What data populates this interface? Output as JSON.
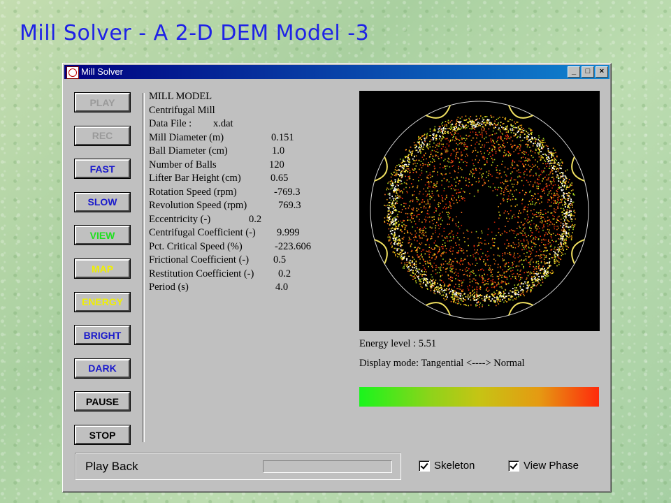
{
  "slide": {
    "title": "Mill Solver - A 2-D DEM Model -3"
  },
  "window": {
    "title": "Mill Solver",
    "controls": {
      "minimize": "_",
      "maximize": "□",
      "close": "×"
    }
  },
  "buttons": [
    {
      "label": "PLAY",
      "color": "#9a9a9a"
    },
    {
      "label": "REC",
      "color": "#9a9a9a"
    },
    {
      "label": "FAST",
      "color": "#1a1acc"
    },
    {
      "label": "SLOW",
      "color": "#1a1acc"
    },
    {
      "label": "VIEW",
      "color": "#20e020"
    },
    {
      "label": "MAP",
      "color": "#f0f000"
    },
    {
      "label": "ENERGY",
      "color": "#f0f000"
    },
    {
      "label": "BRIGHT",
      "color": "#1a1acc"
    },
    {
      "label": "DARK",
      "color": "#1a1acc"
    },
    {
      "label": "PAUSE",
      "color": "#000000"
    },
    {
      "label": "STOP",
      "color": "#000000"
    }
  ],
  "model": {
    "heading": "MILL MODEL",
    "type": "Centrifugal Mill",
    "params": [
      {
        "label": "Data File :",
        "value": "x.dat"
      },
      {
        "label": "Mill Diameter (m)",
        "value": "0.151"
      },
      {
        "label": "Ball Diameter (cm)",
        "value": "1.0"
      },
      {
        "label": "Number of Balls",
        "value": "120"
      },
      {
        "label": "Lifter Bar Height (cm)",
        "value": "0.65"
      },
      {
        "label": "Rotation Speed (rpm)",
        "value": "-769.3"
      },
      {
        "label": "Revolution Speed (rpm)",
        "value": "769.3"
      },
      {
        "label": "Eccentricity (-)",
        "value": "0.2"
      },
      {
        "label": "Centrifugal Coefficient (-)",
        "value": "9.999"
      },
      {
        "label": "Pct. Critical Speed (%)",
        "value": "-223.606"
      },
      {
        "label": "Frictional Coefficient (-)",
        "value": "0.5"
      },
      {
        "label": "Restitution Coefficient (-)",
        "value": "0.2"
      },
      {
        "label": "Period (s)",
        "value": "4.0"
      }
    ]
  },
  "display": {
    "energy_level": "Energy level   : 5.51",
    "display_mode": "Display mode:  Tangential <----> Normal",
    "gradient_colors": [
      "#19f51c",
      "#c6c414",
      "#ff2a0c"
    ]
  },
  "status": {
    "mode": "Play Back",
    "progress": 0
  },
  "checkboxes": [
    {
      "label": "Skeleton",
      "checked": true
    },
    {
      "label": "View Phase",
      "checked": true
    }
  ]
}
